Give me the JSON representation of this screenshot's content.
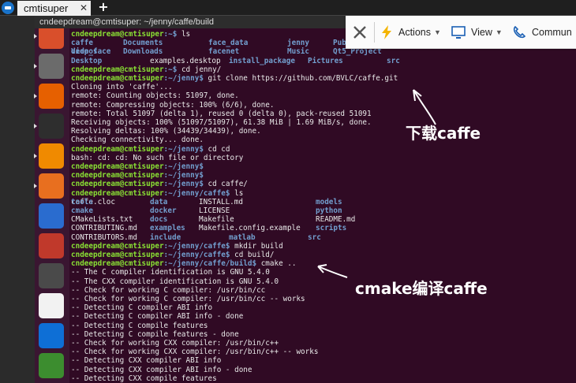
{
  "tab": {
    "title": "cmtisuper",
    "close": "✕",
    "add": "+"
  },
  "window": {
    "title": "cndeepdream@cmtisuper: ~/jenny/caffe/build"
  },
  "toolbar": {
    "actions": "Actions",
    "view": "View",
    "communicate": "Commun"
  },
  "colors": {
    "terminal_bg": "#300a24",
    "prompt": "#8ae234",
    "dir": "#729fcf",
    "launcher_bg": "#3a1631"
  },
  "launcher_icons": [
    "ubuntu-dash-icon",
    "files-icon",
    "firefox-icon",
    "terminal-icon",
    "vlc-icon",
    "software-center-icon",
    "camera-app-icon",
    "system-settings-icon",
    "sublime-text-icon",
    "tux-icon",
    "teamviewer-icon",
    "plant-app-icon"
  ],
  "terminal_lines": [
    {
      "p": "cndeepdream@cmtisuper",
      "path": ":~$",
      "cmd": " ls"
    },
    {
      "cols": [
        {
          "t": "caffe",
          "k": "d"
        },
        {
          "t": "Documents",
          "k": "d"
        },
        {
          "t": "face_data",
          "k": "d"
        },
        {
          "t": "jenny",
          "k": "d"
        },
        {
          "t": "Pub",
          "k": "d"
        }
      ]
    },
    {
      "cols": [
        {
          "t": "deep_face",
          "k": "d"
        },
        {
          "t": "Downloads",
          "k": "d"
        },
        {
          "t": "facenet",
          "k": "d"
        },
        {
          "t": "Music",
          "k": "d"
        },
        {
          "t": "Qt5_Project",
          "k": "d"
        },
        {
          "t": "Videos",
          "k": "d"
        }
      ]
    },
    {
      "cols": [
        {
          "t": "Desktop",
          "k": "d"
        },
        {
          "t": "examples.desktop",
          "k": "f"
        },
        {
          "t": "install_package",
          "k": "d"
        },
        {
          "t": "Pictures",
          "k": "d"
        },
        {
          "t": "src",
          "k": "d"
        }
      ]
    },
    {
      "p": "cndeepdream@cmtisuper",
      "path": ":~$",
      "cmd": " cd jenny/"
    },
    {
      "p": "cndeepdream@cmtisuper",
      "path": ":~/jenny$",
      "cmd": " git clone https://github.com/BVLC/caffe.git"
    },
    {
      "t": "Cloning into 'caffe'..."
    },
    {
      "t": "remote: Counting objects: 51097, done."
    },
    {
      "t": "remote: Compressing objects: 100% (6/6), done."
    },
    {
      "t": "remote: Total 51097 (delta 1), reused 0 (delta 0), pack-reused 51091"
    },
    {
      "t": "Receiving objects: 100% (51097/51097), 61.38 MiB | 1.69 MiB/s, done."
    },
    {
      "t": "Resolving deltas: 100% (34439/34439), done."
    },
    {
      "t": "Checking connectivity... done."
    },
    {
      "p": "cndeepdream@cmtisuper",
      "path": ":~/jenny$",
      "cmd": " cd cd"
    },
    {
      "t": "bash: cd: cd: No such file or directory"
    },
    {
      "p": "cndeepdream@cmtisuper",
      "path": ":~/jenny$",
      "cmd": ""
    },
    {
      "p": "cndeepdream@cmtisuper",
      "path": ":~/jenny$",
      "cmd": ""
    },
    {
      "p": "cndeepdream@cmtisuper",
      "path": ":~/jenny$",
      "cmd": " cd caffe/"
    },
    {
      "p": "cndeepdream@cmtisuper",
      "path": ":~/jenny/caffe$",
      "cmd": " ls"
    },
    {
      "cols": [
        {
          "t": "caffe.cloc",
          "k": "f"
        },
        {
          "t": "data",
          "k": "d"
        },
        {
          "t": "INSTALL.md",
          "k": "f"
        },
        {
          "t": "models",
          "k": "d"
        },
        {
          "t": "tools",
          "k": "d"
        }
      ]
    },
    {
      "cols": [
        {
          "t": "cmake",
          "k": "d"
        },
        {
          "t": "docker",
          "k": "d"
        },
        {
          "t": "LICENSE",
          "k": "f"
        },
        {
          "t": "python",
          "k": "d"
        }
      ]
    },
    {
      "cols": [
        {
          "t": "CMakeLists.txt",
          "k": "f"
        },
        {
          "t": "docs",
          "k": "d"
        },
        {
          "t": "Makefile",
          "k": "f"
        },
        {
          "t": "README.md",
          "k": "f"
        }
      ]
    },
    {
      "cols": [
        {
          "t": "CONTRIBUTING.md",
          "k": "f"
        },
        {
          "t": "examples",
          "k": "d"
        },
        {
          "t": "Makefile.config.example",
          "k": "f"
        },
        {
          "t": "scripts",
          "k": "d"
        }
      ]
    },
    {
      "cols": [
        {
          "t": "CONTRIBUTORS.md",
          "k": "f"
        },
        {
          "t": "include",
          "k": "d"
        },
        {
          "t": "matlab",
          "k": "d"
        },
        {
          "t": "src",
          "k": "d"
        }
      ]
    },
    {
      "p": "cndeepdream@cmtisuper",
      "path": ":~/jenny/caffe$",
      "cmd": " mkdir build"
    },
    {
      "p": "cndeepdream@cmtisuper",
      "path": ":~/jenny/caffe$",
      "cmd": " cd build/"
    },
    {
      "p": "cndeepdream@cmtisuper",
      "path": ":~/jenny/caffe/build$",
      "cmd": " cmake .."
    },
    {
      "t": "-- The C compiler identification is GNU 5.4.0"
    },
    {
      "t": "-- The CXX compiler identification is GNU 5.4.0"
    },
    {
      "t": "-- Check for working C compiler: /usr/bin/cc"
    },
    {
      "t": "-- Check for working C compiler: /usr/bin/cc -- works"
    },
    {
      "t": "-- Detecting C compiler ABI info"
    },
    {
      "t": "-- Detecting C compiler ABI info - done"
    },
    {
      "t": "-- Detecting C compile features"
    },
    {
      "t": "-- Detecting C compile features - done"
    },
    {
      "t": "-- Check for working CXX compiler: /usr/bin/c++"
    },
    {
      "t": "-- Check for working CXX compiler: /usr/bin/c++ -- works"
    },
    {
      "t": "-- Detecting CXX compiler ABI info"
    },
    {
      "t": "-- Detecting CXX compiler ABI info - done"
    },
    {
      "t": "-- Detecting CXX compile features"
    }
  ],
  "annotations": {
    "download": "下载caffe",
    "cmake": "cmake编译caffe"
  }
}
